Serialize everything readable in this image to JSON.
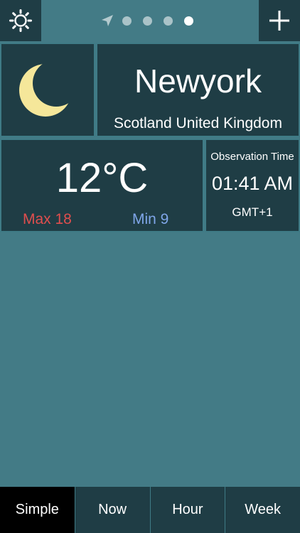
{
  "topbar": {
    "settings_icon": "gear-icon",
    "add_icon": "plus-icon",
    "location_icon": "location-arrow-icon",
    "pages": 4,
    "active_page": 4
  },
  "weather": {
    "city": "Newyork",
    "region": "Scotland United Kingdom",
    "condition_icon": "crescent-moon-icon",
    "temperature": "12°C",
    "max": "Max 18",
    "min": "Min 9",
    "observation_label": "Observation Time",
    "observation_time": "01:41 AM",
    "timezone": "GMT+1"
  },
  "tabs": {
    "simple": "Simple",
    "now": "Now",
    "hour": "Hour",
    "week": "Week",
    "active": "Simple"
  },
  "colors": {
    "background": "#437b86",
    "panel": "#1f3d45",
    "max_temp": "#e04e4e",
    "min_temp": "#7fa6e8",
    "moon": "#f5e79a"
  }
}
